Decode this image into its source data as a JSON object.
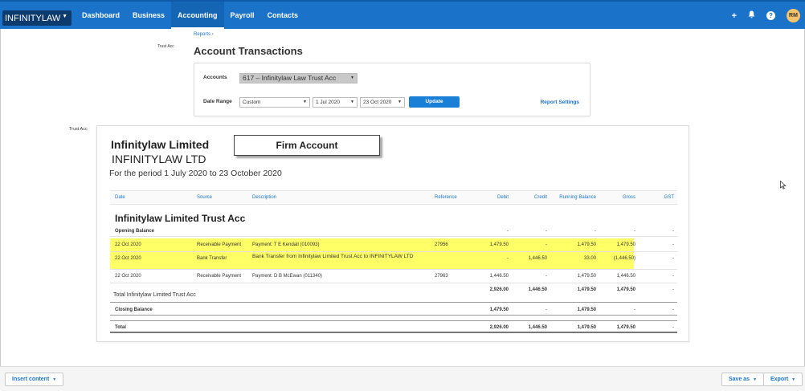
{
  "nav": {
    "org": "INFINITYLAW",
    "items": [
      "Dashboard",
      "Business",
      "Accounting",
      "Payroll",
      "Contacts"
    ],
    "active_index": 2,
    "icons": [
      "plus-icon",
      "bell-icon",
      "help-icon"
    ],
    "plus_glyph": "+",
    "help_glyph": "?",
    "avatar": "RM"
  },
  "breadcrumb": "Reports ›",
  "left_label_1": "Trust Acc",
  "left_label_2": "Trust Acc",
  "page_title": "Account Transactions",
  "filters": {
    "accounts_label": "Accounts",
    "account_value": "617 – Infinitylaw Law Trust Acc",
    "date_range_label": "Date Range",
    "date_range_value": "Custom",
    "from_date": "1 Jul 2020",
    "to_date": "23 Oct 2020",
    "update_label": "Update",
    "report_settings": "Report Settings"
  },
  "report": {
    "org_name": "Infinitylaw Limited",
    "org_name_2": "INFINITYLAW LTD",
    "period": "For the period 1 July 2020 to 23 October 2020",
    "firm_account_label": "Firm Account",
    "columns": [
      "Date",
      "Source",
      "Description",
      "Reference",
      "Debit",
      "Credit",
      "Running Balance",
      "Gross",
      "GST"
    ],
    "section_title": "Infinitylaw Limited Trust Acc",
    "opening": {
      "label": "Opening Balance",
      "debit": "-",
      "credit": "-",
      "running": "-",
      "gross": "-",
      "gst": "-"
    },
    "rows": [
      {
        "date": "22 Oct 2020",
        "source": "Receivable Payment",
        "description": "Payment: T E Kendall (010093)",
        "reference": "27956",
        "debit": "1,479.50",
        "credit": "-",
        "running": "1,479.50",
        "gross": "1,479.50",
        "gst": "-"
      },
      {
        "date": "22 Oct 2020",
        "source": "Bank Transfer",
        "description": "Bank Transfer from Infinitylaw Limited Trust Acc to INFINITYLAW LTD",
        "reference": "",
        "debit": "-",
        "credit": "1,446.50",
        "running": "33.00",
        "gross": "(1,446.50)",
        "gst": "-"
      },
      {
        "date": "22 Oct 2020",
        "source": "Receivable Payment",
        "description": "Payment: D B McEwan (011340)",
        "reference": "27963",
        "debit": "1,446.50",
        "credit": "-",
        "running": "1,479.50",
        "gross": "1,446.50",
        "gst": "-"
      }
    ],
    "total_section": {
      "label": "Total Infinitylaw Limited Trust Acc",
      "debit": "2,926.00",
      "credit": "1,446.50",
      "running": "1,479.50",
      "gross": "1,479.50",
      "gst": "-"
    },
    "closing": {
      "label": "Closing Balance",
      "debit": "1,479.50",
      "credit": "-",
      "running": "1,479.50",
      "gross": "-",
      "gst": "-"
    },
    "total": {
      "label": "Total",
      "debit": "2,926.00",
      "credit": "1,446.50",
      "running": "1,479.50",
      "gross": "1,479.50",
      "gst": "-"
    }
  },
  "footer": {
    "insert_content": "Insert content",
    "save_as": "Save as",
    "export": "Export"
  }
}
